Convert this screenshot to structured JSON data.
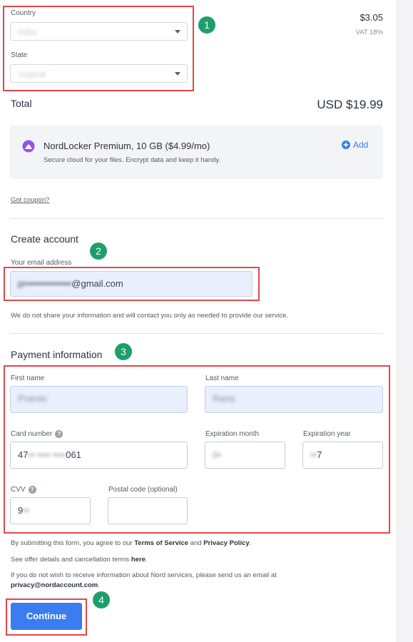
{
  "location": {
    "country_label": "Country",
    "country_value": "India",
    "state_label": "State",
    "state_value": "Gujarat"
  },
  "tax": {
    "amount": "$3.05",
    "note": "VAT 18%"
  },
  "total": {
    "label": "Total",
    "amount": "USD $19.99"
  },
  "addon": {
    "title": "NordLocker Premium, 10 GB ($4.99/mo)",
    "description": "Secure cloud for your files. Encrypt data and keep it handy.",
    "add_label": "Add"
  },
  "coupon_link": "Got coupon?",
  "account": {
    "heading": "Create account",
    "email_label": "Your email address",
    "email_value_blurred": "pr••••••••••••••",
    "email_value_domain": "@gmail.com",
    "privacy_note": "We do not share your information and will contact you only as needed to provide our service."
  },
  "payment": {
    "heading": "Payment information",
    "first_name_label": "First name",
    "first_name_value": "Pranav",
    "last_name_label": "Last name",
    "last_name_value": "Rana",
    "card_label": "Card number",
    "card_value_start": "47",
    "card_value_blurred": "•• •••• ••••",
    "card_value_end": "061",
    "exp_month_label": "Expiration month",
    "exp_month_value": "0•",
    "exp_year_label": "Expiration year",
    "exp_year_value_blurred": "••",
    "exp_year_value_end": "7",
    "cvv_label": "CVV",
    "cvv_value_start": "9",
    "cvv_value_blurred": "••",
    "postal_label": "Postal code (optional)",
    "postal_value": ""
  },
  "legal": {
    "line1_prefix": "By submitting this form, you agree to our ",
    "terms": "Terms of Service",
    "and": " and ",
    "privacy": "Privacy Policy",
    "period": ".",
    "line2_prefix": "See offer details and cancellation terms ",
    "here": "here",
    "line3": "If you do not wish to receive information about Nord services, please send us an email at",
    "email": "privacy@nordaccount.com"
  },
  "continue_label": "Continue",
  "annotations": {
    "one": "1",
    "two": "2",
    "three": "3",
    "four": "4"
  },
  "colors": {
    "accent": "#3b7cf0",
    "annotation_red": "#e0474c",
    "annotation_green": "#1e9e6a"
  },
  "icons": {
    "addon": "nordlocker-logo-icon",
    "add": "plus-circle-icon",
    "help": "question-circle-icon",
    "dropdown": "chevron-down-icon"
  }
}
